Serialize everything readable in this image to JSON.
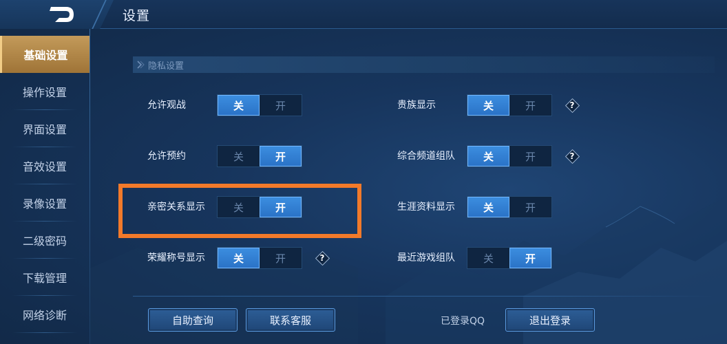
{
  "header": {
    "title": "设置",
    "back_icon": "back-arrow-icon"
  },
  "sidebar": {
    "items": [
      {
        "label": "基础设置",
        "active": true
      },
      {
        "label": "操作设置",
        "active": false
      },
      {
        "label": "界面设置",
        "active": false
      },
      {
        "label": "音效设置",
        "active": false
      },
      {
        "label": "录像设置",
        "active": false
      },
      {
        "label": "二级密码",
        "active": false
      },
      {
        "label": "下载管理",
        "active": false
      },
      {
        "label": "网络诊断",
        "active": false
      }
    ]
  },
  "section": {
    "title": "隐私设置"
  },
  "toggle_labels": {
    "off": "关",
    "on": "开"
  },
  "settings": {
    "left": [
      {
        "label": "允许观战",
        "value": "关",
        "help": false
      },
      {
        "label": "允许预约",
        "value": "开",
        "help": false
      },
      {
        "label": "亲密关系显示",
        "value": "开",
        "help": false
      },
      {
        "label": "荣耀称号显示",
        "value": "关",
        "help": true
      }
    ],
    "right": [
      {
        "label": "贵族显示",
        "value": "关",
        "help": true
      },
      {
        "label": "综合频道组队",
        "value": "关",
        "help": true
      },
      {
        "label": "生涯资料显示",
        "value": "关",
        "help": false
      },
      {
        "label": "最近游戏组队",
        "value": "开",
        "help": false
      }
    ]
  },
  "help_glyph": "?",
  "footer": {
    "self_query_label": "自助查询",
    "contact_service_label": "联系客服",
    "login_status": "已登录QQ",
    "logout_label": "退出登录"
  },
  "colors": {
    "accent_on": "#3c8ee0",
    "sidebar_active": "#c39a5a",
    "highlight": "#f27a2a"
  }
}
